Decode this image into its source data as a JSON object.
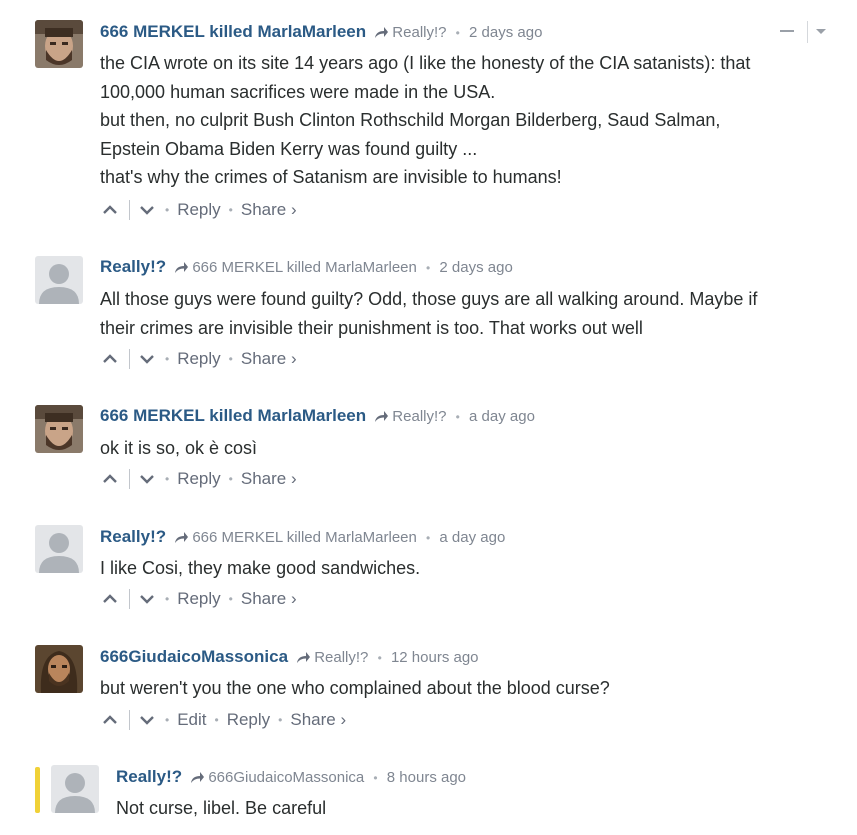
{
  "ui": {
    "reply_label": "Reply",
    "share_label": "Share ›",
    "edit_label": "Edit"
  },
  "comments": [
    {
      "author": "666 MERKEL killed MarlaMarleen",
      "parent": "Really!?",
      "time": "2 days ago",
      "avatar": "bearded-man-photo",
      "lines": [
        "the CIA wrote on its site 14 years ago (I like the honesty of the CIA satanists): that",
        "100,000 human sacrifices were made in the USA.",
        "but then, no culprit Bush Clinton Rothschild Morgan Bilderberg, Saud Salman,",
        "Epstein Obama Biden Kerry was found guilty ...",
        "that's why the crimes of Satanism are invisible to humans!"
      ]
    },
    {
      "author": "Really!?",
      "parent": "666 MERKEL killed MarlaMarleen",
      "time": "2 days ago",
      "avatar": "default-user",
      "lines": [
        "All those guys were found guilty? Odd, those guys are all walking around. Maybe if",
        "their crimes are invisible their punishment is too. That works out well"
      ]
    },
    {
      "author": "666 MERKEL killed MarlaMarleen",
      "parent": "Really!?",
      "time": "a day ago",
      "avatar": "bearded-man-photo",
      "lines": [
        "ok it is so, ok è così"
      ]
    },
    {
      "author": "Really!?",
      "parent": "666 MERKEL killed MarlaMarleen",
      "time": "a day ago",
      "avatar": "default-user",
      "lines": [
        "I like Cosi, they make good sandwiches."
      ]
    },
    {
      "author": "666GiudaicoMassonica",
      "parent": "Really!?",
      "time": "12 hours ago",
      "avatar": "painted-portrait",
      "lines": [
        "but weren't you the one who complained about the blood curse?"
      ]
    },
    {
      "author": "Really!?",
      "parent": "666GiudaicoMassonica",
      "time": "8 hours ago",
      "avatar": "default-user",
      "lines": [
        "Not curse, libel. Be careful"
      ]
    }
  ],
  "colors": {
    "author": "#2b5a85",
    "meta": "#7f8691",
    "text": "#2a2e2e",
    "highlight": "#f0d137"
  }
}
